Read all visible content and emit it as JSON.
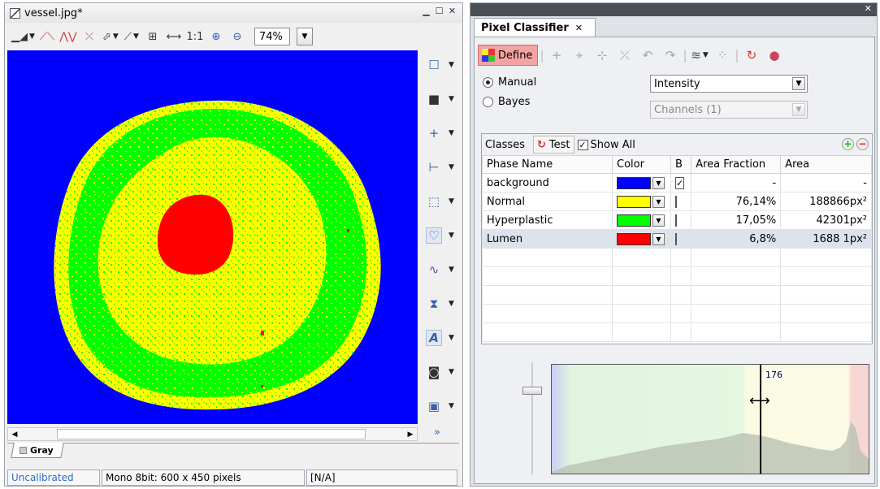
{
  "image_window": {
    "title": "vessel.jpg*",
    "toolbar": {
      "one_to_one": "1:1",
      "zoom": "74%"
    },
    "tab": "Gray",
    "status": {
      "calibration": "Uncalibrated",
      "image_info": "Mono 8bit: 600 x 450 pixels",
      "value": "[N/A]"
    },
    "colors": {
      "background": "#0000ff",
      "normal": "#ffff00",
      "hyperplastic": "#00ff00",
      "lumen": "#ff0000"
    }
  },
  "classifier": {
    "tab_title": "Pixel Classifier",
    "define_label": "Define",
    "modes": {
      "manual": "Manual",
      "bayes": "Bayes",
      "selected": "manual"
    },
    "feature_select": "Intensity",
    "channels_select": "Channels (1)",
    "classes": {
      "label": "Classes",
      "test_label": "Test",
      "show_all_label": "Show All",
      "show_all_checked": true,
      "columns": {
        "name": "Phase Name",
        "color": "Color",
        "b": "B",
        "fraction": "Area Fraction",
        "area": "Area"
      },
      "rows": [
        {
          "name": "background",
          "color": "#0000ff",
          "b": true,
          "fraction": "-",
          "area": "-"
        },
        {
          "name": "Normal",
          "color": "#ffff00",
          "b": false,
          "fraction": "76,14%",
          "area": "188866px²"
        },
        {
          "name": "Hyperplastic",
          "color": "#00ff00",
          "b": false,
          "fraction": "17,05%",
          "area": "42301px²"
        },
        {
          "name": "Lumen",
          "color": "#ff0000",
          "b": false,
          "fraction": "6,8%",
          "area": "1688 1px²",
          "selected": true
        }
      ]
    },
    "histogram": {
      "threshold_label": "176",
      "threshold": 176,
      "range": [
        0,
        255
      ]
    }
  }
}
